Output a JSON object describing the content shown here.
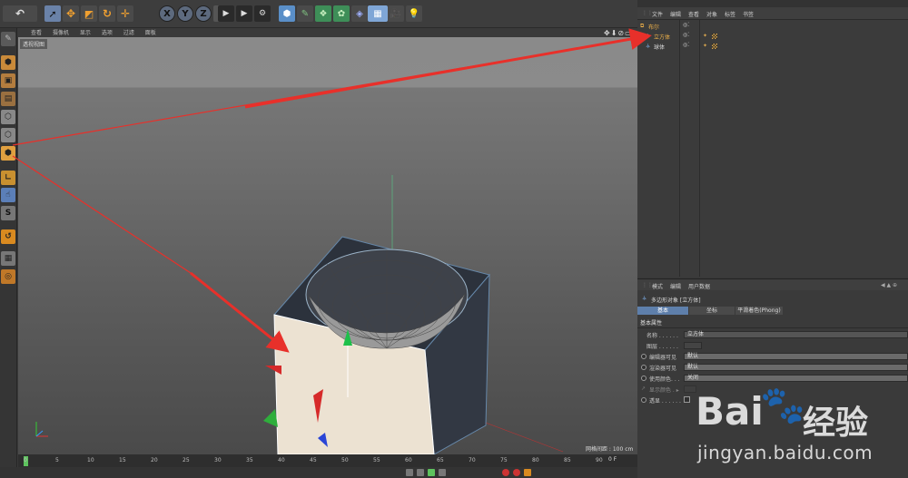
{
  "viewport": {
    "menu": [
      "查看",
      "摄像机",
      "显示",
      "选项",
      "过滤",
      "面板"
    ],
    "label": "透视视图",
    "grid_spacing": "网格间距 : 100 cm"
  },
  "toolbar": {
    "axis_x": "X",
    "axis_y": "Y",
    "axis_z": "Z"
  },
  "timeline": {
    "ticks": [
      "0",
      "5",
      "10",
      "15",
      "20",
      "25",
      "30",
      "35",
      "40",
      "45",
      "50",
      "55",
      "60",
      "65",
      "70",
      "75",
      "80",
      "85",
      "90"
    ],
    "end_frame": "0 F"
  },
  "object_manager": {
    "menu": [
      "文件",
      "编辑",
      "查看",
      "对象",
      "标签",
      "书签"
    ],
    "objects": [
      {
        "name": "立方体",
        "selected": true
      },
      {
        "name": "球体",
        "selected": false
      }
    ]
  },
  "attributes": {
    "menu": [
      "模式",
      "编辑",
      "用户数据"
    ],
    "header": "多边形对象 [立方体]",
    "tabs": [
      "基本",
      "坐标",
      "平滑着色(Phong)"
    ],
    "section": "基本属性",
    "rows": [
      {
        "label": "名称 . . . . . .",
        "value": "立方体"
      },
      {
        "label": "图层 . . . . . .",
        "value": ""
      },
      {
        "label": "编辑器可见",
        "value": "默认"
      },
      {
        "label": "渲染器可见",
        "value": "默认"
      },
      {
        "label": "使用颜色. . .",
        "value": "关闭"
      },
      {
        "label": "显示颜色 . ▸",
        "value": ""
      },
      {
        "label": "透显 . . . . . .",
        "value": ""
      }
    ]
  },
  "watermark": {
    "brand": "Bai",
    "cn": "经验",
    "url": "jingyan.baidu.com"
  },
  "colors": {
    "accent_orange": "#f0a030",
    "arrow_red": "#e8302a",
    "selected_text": "#f2b34a"
  }
}
